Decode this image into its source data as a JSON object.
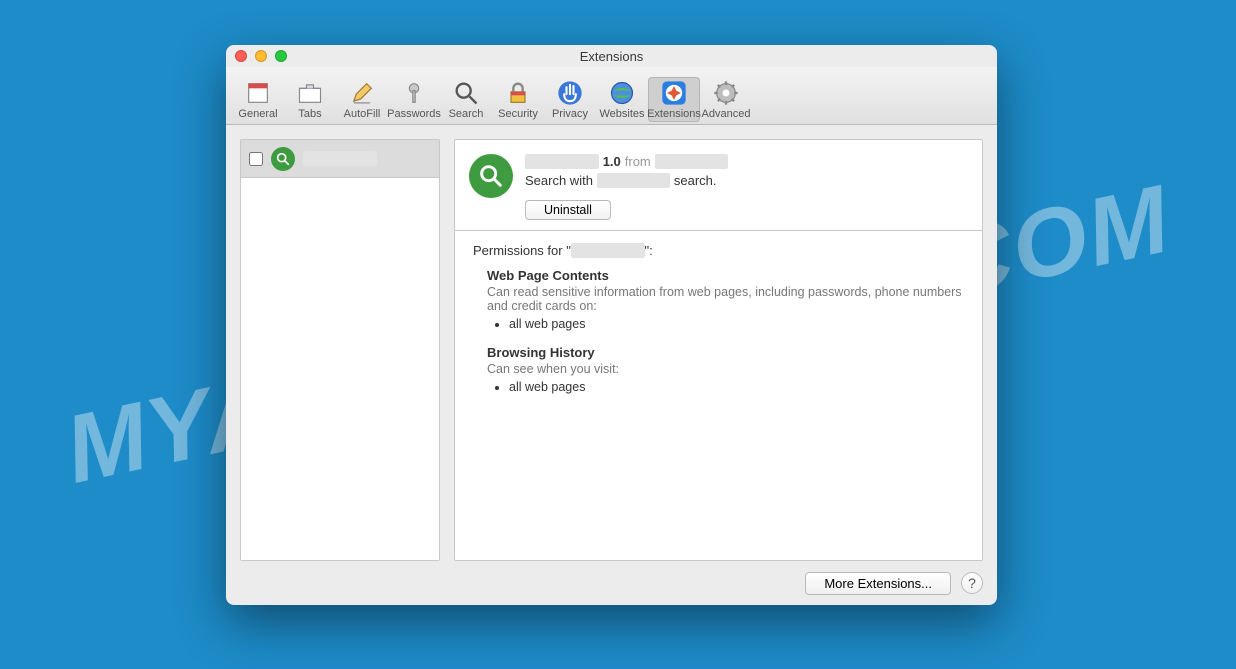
{
  "watermark": "MYANTISPYWARE.COM",
  "window_title": "Extensions",
  "toolbar": [
    {
      "label": "General"
    },
    {
      "label": "Tabs"
    },
    {
      "label": "AutoFill"
    },
    {
      "label": "Passwords"
    },
    {
      "label": "Search"
    },
    {
      "label": "Security"
    },
    {
      "label": "Privacy"
    },
    {
      "label": "Websites"
    },
    {
      "label": "Extensions"
    },
    {
      "label": "Advanced"
    }
  ],
  "sidebar": {
    "ext_name_redacted": "████████"
  },
  "detail": {
    "name_redacted": "████████",
    "version": "1.0",
    "from_label": "from",
    "vendor_redacted": "████████",
    "desc_prefix": "Search with",
    "desc_mid_redacted": "████████",
    "desc_suffix": "search.",
    "uninstall": "Uninstall"
  },
  "permissions": {
    "header_prefix": "Permissions for \"",
    "header_name_redacted": "████████",
    "header_suffix": "\":",
    "blocks": [
      {
        "title": "Web Page Contents",
        "desc": "Can read sensitive information from web pages, including passwords, phone numbers and credit cards on:",
        "items": [
          "all web pages"
        ]
      },
      {
        "title": "Browsing History",
        "desc": "Can see when you visit:",
        "items": [
          "all web pages"
        ]
      }
    ]
  },
  "footer": {
    "more": "More Extensions...",
    "help": "?"
  }
}
